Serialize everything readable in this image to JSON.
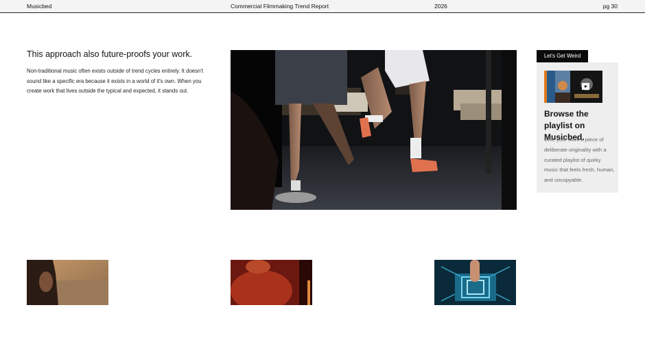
{
  "header": {
    "brand": "Musicbed",
    "report_title": "Commercial Filmmaking Trend Report",
    "year": "2026",
    "page": "pg 30"
  },
  "article": {
    "headline": "This approach also future-proofs your work.",
    "body": "Non-traditional music often exists outside of trend cycles entirely. It doesn't sound like a specific era because it exists in a world of it's own. When you create work that lives outside the typical and expected, it stands out."
  },
  "promo": {
    "tag": "Let's Get Weird",
    "title": "Browse the playlist on Musicbed.",
    "description": "Give your work a piece of deliberate originality with a curated playlist of quirky music that feels fresh, human, and uncopyable.",
    "thumbnail_icon": "play-icon"
  },
  "colors": {
    "header_bg": "#f4f4f4",
    "promo_bg": "#eeeeee",
    "tag_bg": "#0b0b0b"
  }
}
